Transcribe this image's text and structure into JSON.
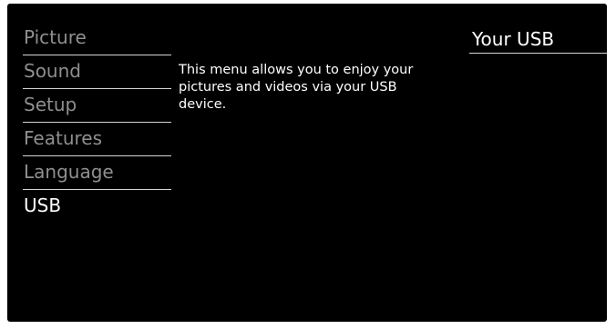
{
  "menu": {
    "items": [
      {
        "label": "Picture"
      },
      {
        "label": "Sound"
      },
      {
        "label": "Setup"
      },
      {
        "label": "Features"
      },
      {
        "label": "Language"
      },
      {
        "label": "USB"
      }
    ],
    "selected_label": "USB"
  },
  "description": "This menu allows you to enjoy your pictures and videos via your USB device.",
  "right_panel": {
    "title": "Your USB"
  },
  "colors": {
    "background": "#000000",
    "menu_text": "#8f8f8f",
    "selected_text": "#ffffff",
    "divider": "#d6d6d6"
  }
}
